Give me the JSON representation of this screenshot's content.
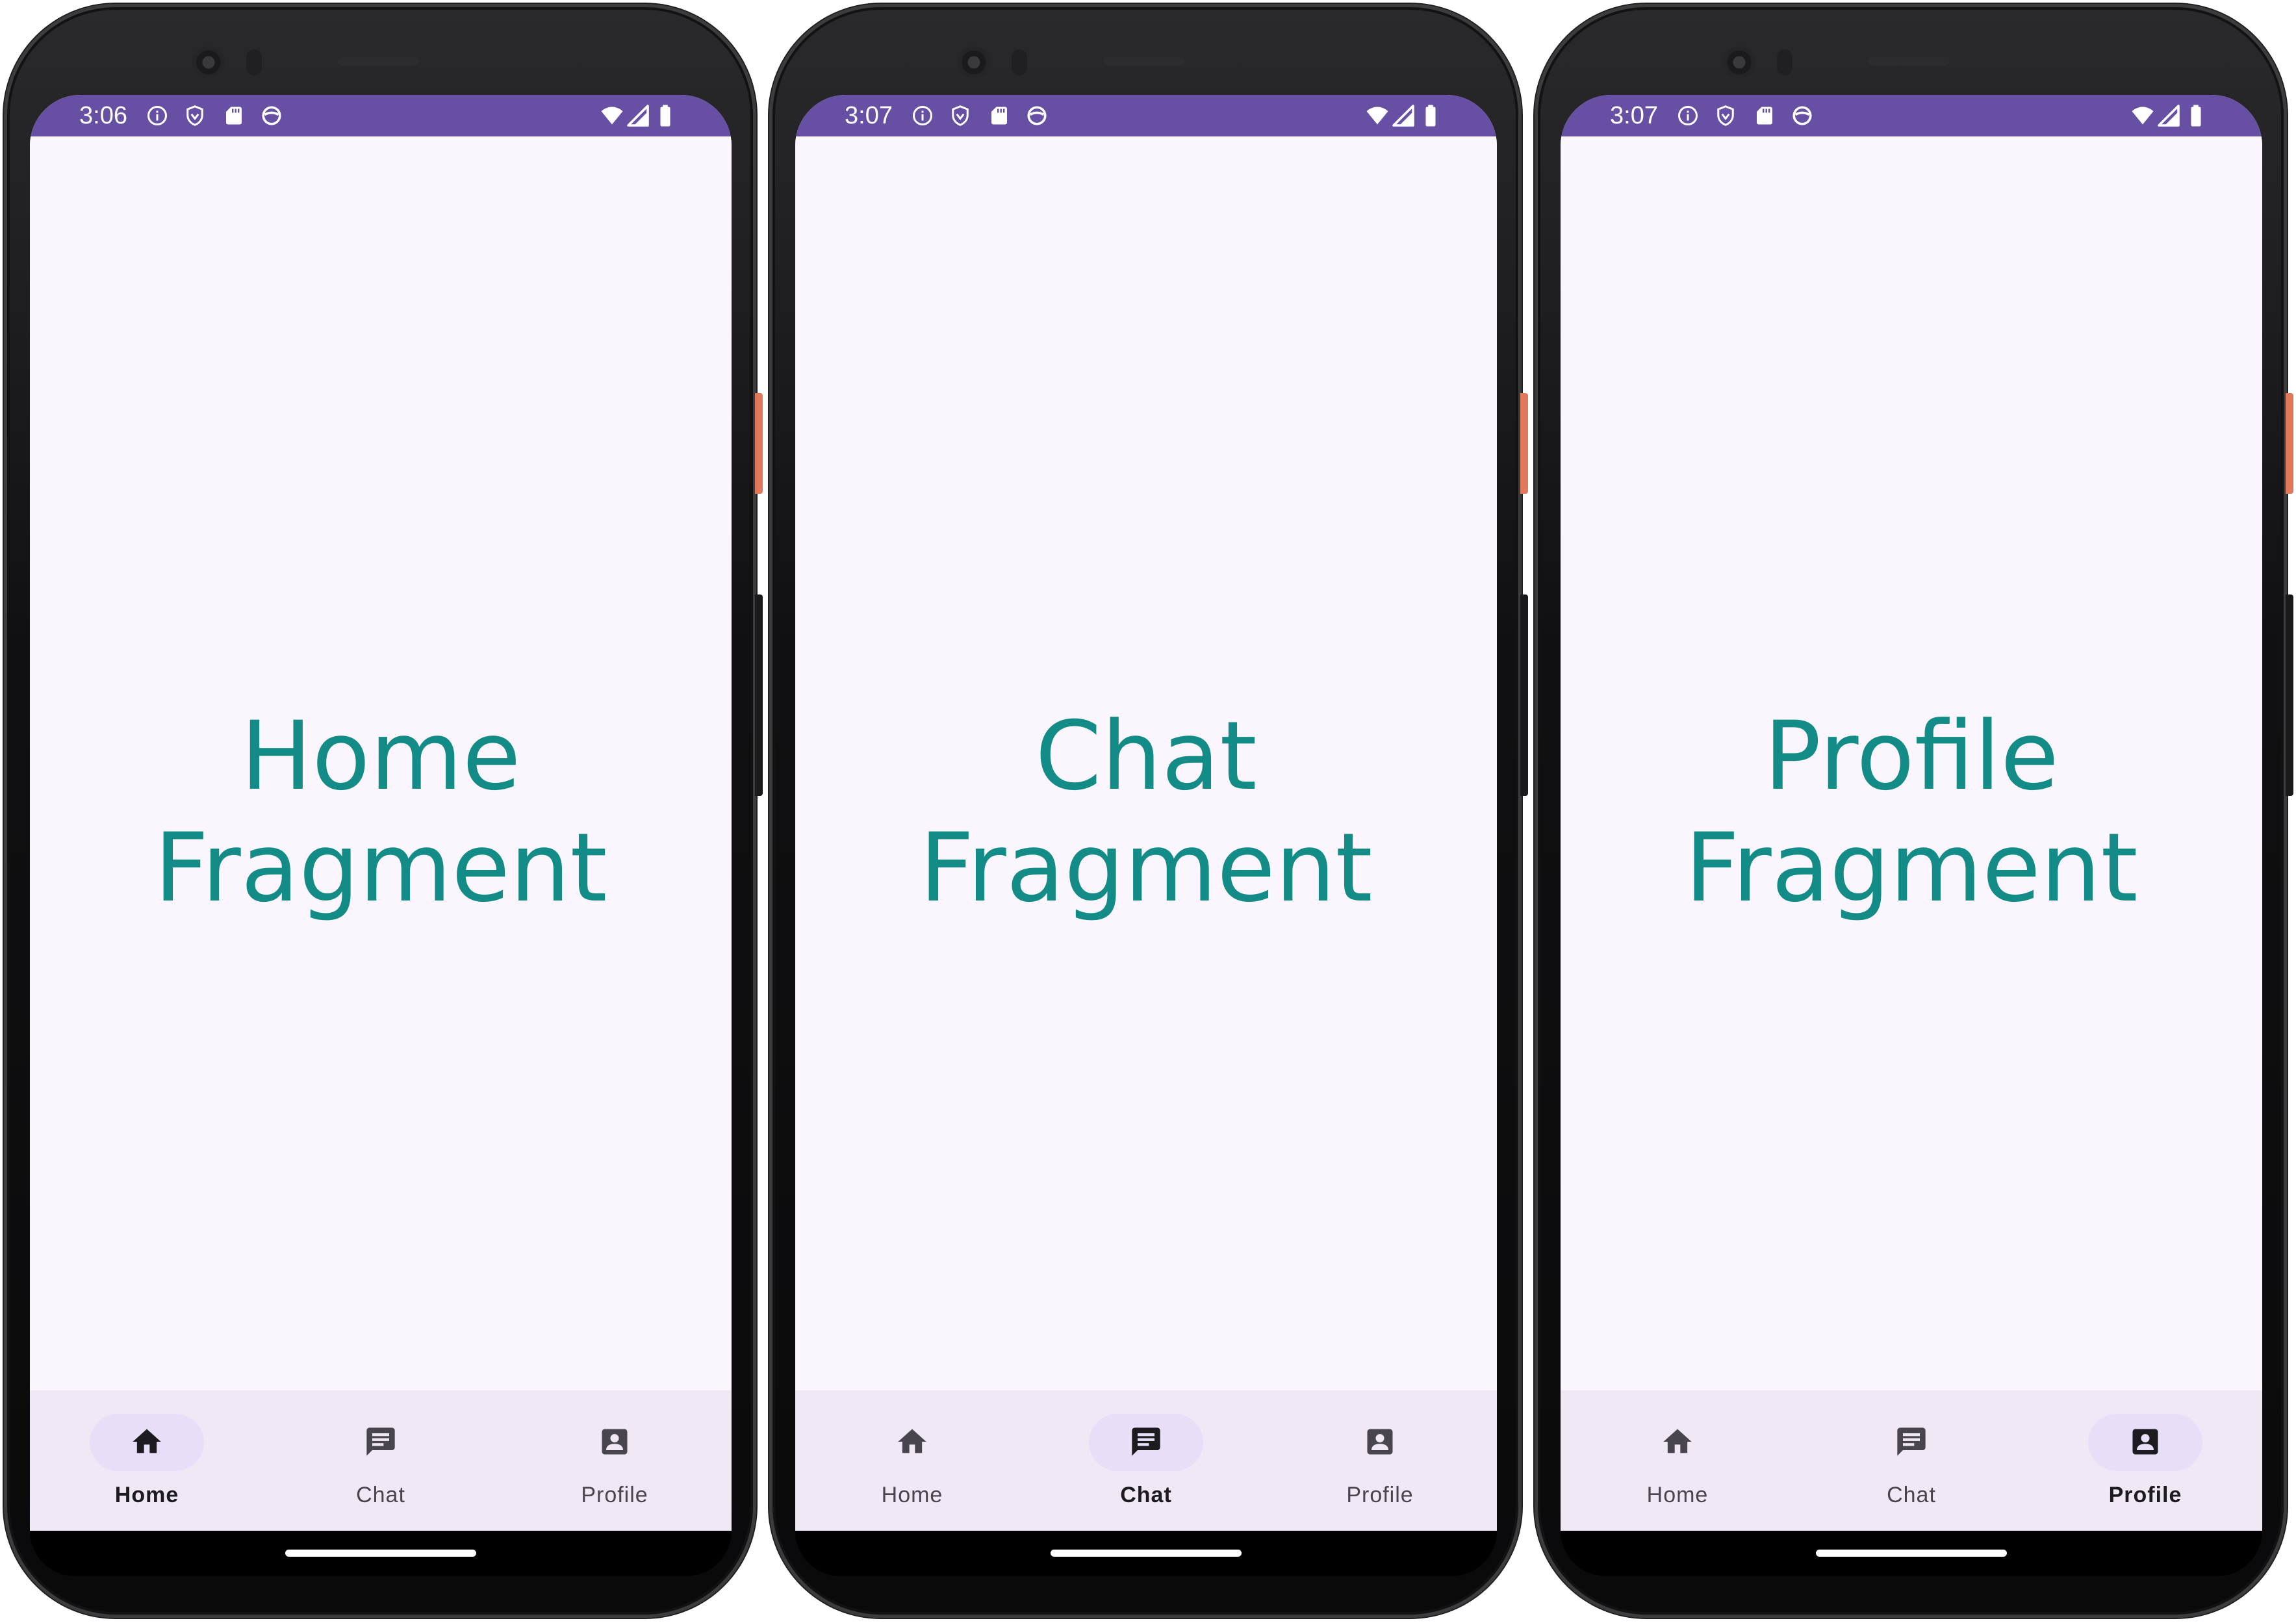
{
  "colors": {
    "status_bar": "#6750a4",
    "screen_background": "#fbf5fd",
    "fragment_text": "#138c87",
    "nav_background": "#f1e8f6",
    "nav_active_pill": "#e8def8",
    "nav_label_inactive": "#49454f",
    "nav_label_active": "#1d1b20"
  },
  "phones": [
    {
      "status_bar": {
        "time": "3:06",
        "icons": [
          "info-icon",
          "shield-icon",
          "sd-card-icon",
          "sync-icon",
          "wifi-icon",
          "signal-icon",
          "battery-icon"
        ]
      },
      "fragment": {
        "line1": "Home",
        "line2": "Fragment"
      },
      "bottom_nav": {
        "selected": "Home",
        "items": [
          {
            "label": "Home",
            "icon": "home-icon",
            "active": true
          },
          {
            "label": "Chat",
            "icon": "chat-icon",
            "active": false
          },
          {
            "label": "Profile",
            "icon": "profile-icon",
            "active": false
          }
        ]
      }
    },
    {
      "status_bar": {
        "time": "3:07",
        "icons": [
          "info-icon",
          "shield-icon",
          "sd-card-icon",
          "sync-icon",
          "wifi-icon",
          "signal-icon",
          "battery-icon"
        ]
      },
      "fragment": {
        "line1": "Chat",
        "line2": "Fragment"
      },
      "bottom_nav": {
        "selected": "Chat",
        "items": [
          {
            "label": "Home",
            "icon": "home-icon",
            "active": false
          },
          {
            "label": "Chat",
            "icon": "chat-icon",
            "active": true
          },
          {
            "label": "Profile",
            "icon": "profile-icon",
            "active": false
          }
        ]
      }
    },
    {
      "status_bar": {
        "time": "3:07",
        "icons": [
          "info-icon",
          "shield-icon",
          "sd-card-icon",
          "sync-icon",
          "wifi-icon",
          "signal-icon",
          "battery-icon"
        ]
      },
      "fragment": {
        "line1": "Profile",
        "line2": "Fragment"
      },
      "bottom_nav": {
        "selected": "Profile",
        "items": [
          {
            "label": "Home",
            "icon": "home-icon",
            "active": false
          },
          {
            "label": "Chat",
            "icon": "chat-icon",
            "active": false
          },
          {
            "label": "Profile",
            "icon": "profile-icon",
            "active": true
          }
        ]
      }
    }
  ]
}
